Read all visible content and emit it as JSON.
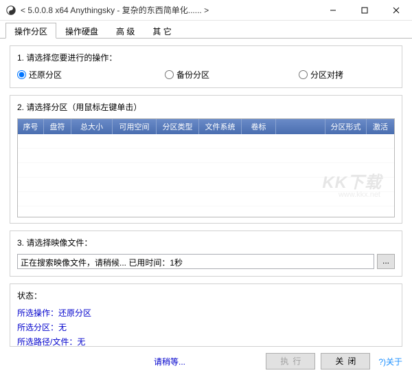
{
  "window": {
    "title": "< 5.0.0.8 x64 Anythingsky - 复杂的东西简单化...... >"
  },
  "tabs": {
    "t0": "操作分区",
    "t1": "操作硬盘",
    "t2": "高 级",
    "t3": "其 它"
  },
  "section1": {
    "title": "1. 请选择您要进行的操作：",
    "opt_restore": "还原分区",
    "opt_backup": "备份分区",
    "opt_copy": "分区对拷"
  },
  "section2": {
    "title": "2. 请选择分区（用鼠标左键单击）",
    "headers": {
      "seq": "序号",
      "drive": "盘符",
      "tsize": "总大小",
      "free": "可用空间",
      "ptype": "分区类型",
      "fs": "文件系统",
      "label": "卷标",
      "form": "分区形式",
      "active": "激活"
    }
  },
  "watermark": {
    "main": "KK下载",
    "sub": "www.kkx.net"
  },
  "section3": {
    "title": "3. 请选择映像文件：",
    "value": "正在搜索映像文件，请稍候...    已用时间：1秒",
    "browse": "..."
  },
  "status": {
    "title": "状态：",
    "l1_label": "所选操作：",
    "l1_value": "还原分区",
    "l2_label": "所选分区：",
    "l2_value": "无",
    "l3_label": "所选路径/文件：",
    "l3_value": "无"
  },
  "footer": {
    "wait": "请稍等...",
    "execute": "执行",
    "close": "关闭",
    "about": "?)关于"
  }
}
